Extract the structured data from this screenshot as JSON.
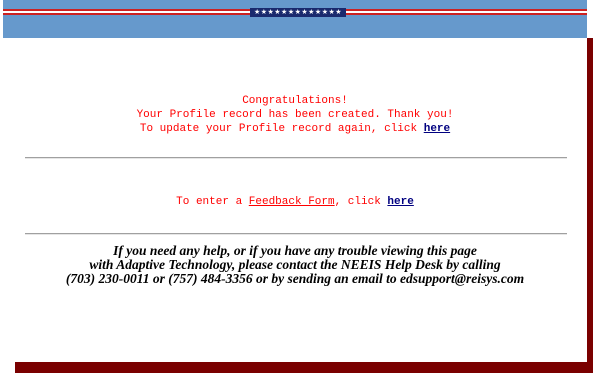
{
  "banner": {
    "stars": "★★★★★★★★★★★★★"
  },
  "confirmation": {
    "line1": "Congratulations!",
    "line2": "Your Profile record has been created. Thank you!",
    "line3_prefix": "To update your Profile record again, click ",
    "line3_link": "here"
  },
  "feedback": {
    "prefix": "To enter a ",
    "form_link": "Feedback Form",
    "middle": ", click ",
    "here_link": "here"
  },
  "help": {
    "line1": "If you need any help, or if you have any trouble viewing this page",
    "line2": "with Adaptive Technology, please contact the NEEIS Help Desk by calling",
    "line3": "(703) 230-0011 or (757) 484-3356 or by sending an email to edsupport@reisys.com"
  },
  "colors": {
    "banner_blue": "#6699cc",
    "stripe_red": "#cc2222",
    "text_red": "#ff0000",
    "link_navy": "#000080",
    "shadow_maroon": "#7a0000"
  }
}
